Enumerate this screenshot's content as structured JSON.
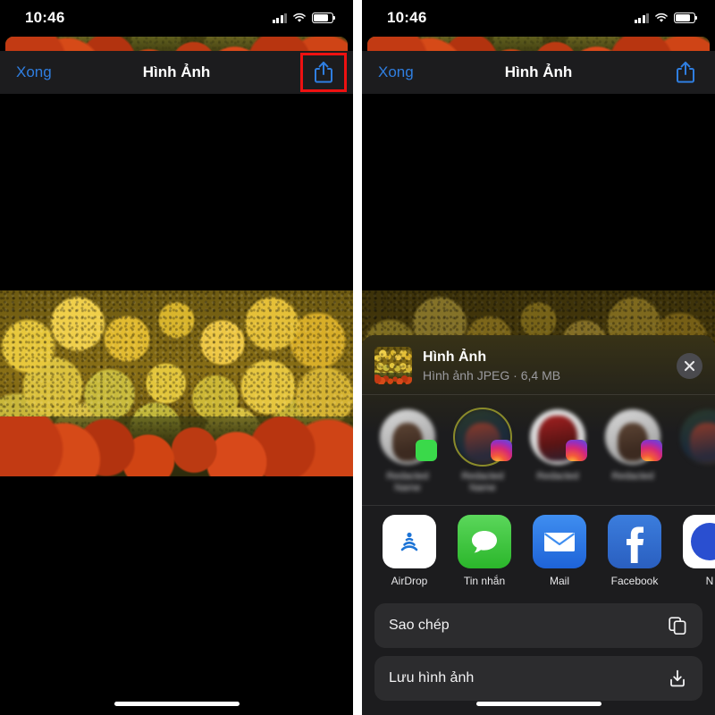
{
  "status_bar": {
    "time": "10:46",
    "signal_icon": "cellular-bars-icon",
    "wifi_icon": "wifi-icon",
    "battery_icon": "battery-icon"
  },
  "nav": {
    "done_label": "Xong",
    "title": "Hình Ảnh",
    "share_icon": "share-icon"
  },
  "left_panel": {
    "name": "photo-viewer-screen",
    "highlight_color": "#ee1111"
  },
  "share_sheet": {
    "header": {
      "title": "Hình Ảnh",
      "subtitle": "Hình ảnh JPEG · 6,4 MB",
      "close_icon": "close-icon",
      "thumbnail": "photo-thumbnail"
    },
    "contacts": [
      {
        "name": "",
        "badge": "messages-badge"
      },
      {
        "name": "",
        "badge": "instagram-badge"
      },
      {
        "name": "",
        "badge": "instagram-badge"
      },
      {
        "name": "",
        "badge": "instagram-badge"
      }
    ],
    "apps": [
      {
        "label": "AirDrop",
        "icon": "airdrop-icon"
      },
      {
        "label": "Tin nhắn",
        "icon": "messages-icon"
      },
      {
        "label": "Mail",
        "icon": "mail-icon"
      },
      {
        "label": "Facebook",
        "icon": "facebook-icon"
      },
      {
        "label": "N",
        "icon": "notes-icon"
      }
    ],
    "actions": [
      {
        "label": "Sao chép",
        "icon": "copy-icon"
      },
      {
        "label": "Lưu hình ảnh",
        "icon": "save-download-icon"
      }
    ]
  },
  "colors": {
    "accent_blue": "#2f7ee0",
    "sheet_bg": "#1c1c1e",
    "row_bg": "#2c2c2e",
    "highlight_red": "#ee1111"
  }
}
